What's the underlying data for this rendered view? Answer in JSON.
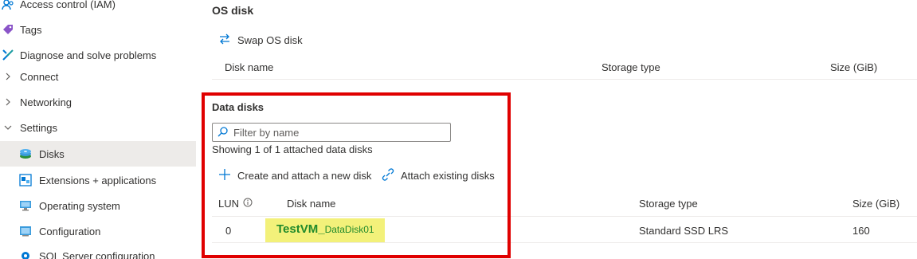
{
  "sidebar": {
    "items": [
      {
        "label": "Access control (IAM)",
        "icon": "people-icon"
      },
      {
        "label": "Tags",
        "icon": "tag-icon"
      },
      {
        "label": "Diagnose and solve problems",
        "icon": "wrench-icon"
      },
      {
        "label": "Connect",
        "icon": "chevron-right-icon"
      },
      {
        "label": "Networking",
        "icon": "chevron-right-icon"
      },
      {
        "label": "Settings",
        "icon": "chevron-down-icon"
      },
      {
        "label": "Disks",
        "icon": "disk-icon",
        "selected": true
      },
      {
        "label": "Extensions + applications",
        "icon": "extensions-icon"
      },
      {
        "label": "Operating system",
        "icon": "monitor-icon"
      },
      {
        "label": "Configuration",
        "icon": "configuration-icon"
      },
      {
        "label": "SQL Server configuration",
        "icon": "sql-gear-icon"
      }
    ]
  },
  "os_disk": {
    "title": "OS disk",
    "swap_label": "Swap OS disk",
    "columns": [
      "Disk name",
      "Storage type",
      "Size (GiB)"
    ]
  },
  "data_disks": {
    "title": "Data disks",
    "filter_placeholder": "Filter by name",
    "showing_text": "Showing 1 of 1 attached data disks",
    "create_label": "Create and attach a new disk",
    "attach_label": "Attach existing disks",
    "columns": [
      "LUN",
      "Disk name",
      "Storage type",
      "Size (GiB)"
    ],
    "rows": [
      {
        "lun": "0",
        "name_prefix": "TestVM_",
        "name_suffix": "DataDisk01",
        "storage_type": "Standard SSD LRS",
        "size": "160"
      }
    ]
  },
  "colors": {
    "accent": "#0078d4",
    "highlight_box": "#e00000",
    "disk_link_bg": "#f3f17a",
    "disk_link_text": "#218a2b"
  }
}
